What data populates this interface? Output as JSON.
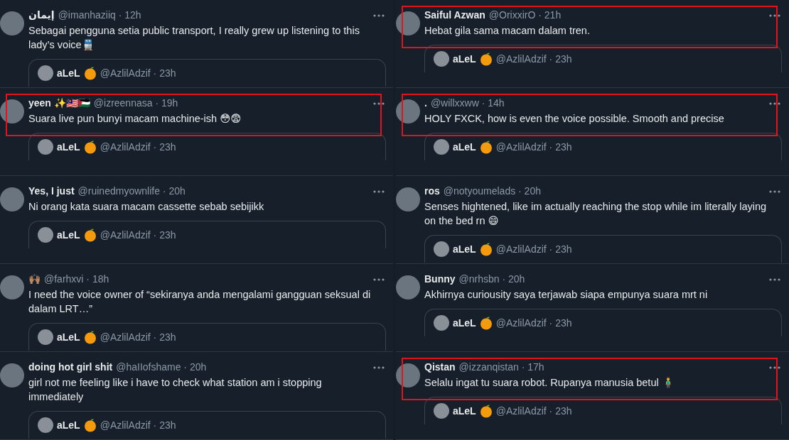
{
  "columns": [
    {
      "tweets": [
        {
          "name": "إيمان",
          "meta": "@imanhaziiq · 12h",
          "text": "Sebagai pengguna setia public transport, I really grew up listening to this lady’s voice🚆",
          "highlighted": false,
          "quote": {
            "name": "aLeL",
            "meta": "@AzlilAdzif · 23h"
          }
        },
        {
          "name": "yeen ✨🇲🇾🇵🇸",
          "meta": "@izreennasa · 19h",
          "text": "Suara live pun bunyi macam machine-ish 😳😨",
          "highlighted": true,
          "quote": {
            "name": "aLeL",
            "meta": "@AzlilAdzif · 23h"
          }
        },
        {
          "name": "Yes, I just",
          "meta": "@ruinedmyownlife · 20h",
          "text": "Ni orang kata suara macam cassette sebab sebijikk",
          "highlighted": false,
          "quote": {
            "name": "aLeL",
            "meta": "@AzlilAdzif · 23h"
          }
        },
        {
          "name": "🙌🏽",
          "meta": "@farhxvi · 18h",
          "text": "I need the voice owner of “sekiranya anda mengalami gangguan seksual di dalam LRT…”",
          "highlighted": false,
          "quote": {
            "name": "aLeL",
            "meta": "@AzlilAdzif · 23h"
          }
        },
        {
          "name": "doing hot girl shit",
          "meta": "@haIIofshame · 20h",
          "text": "girl not me feeling like i have to check what station am i stopping immediately",
          "highlighted": false,
          "quote": {
            "name": "aLeL",
            "meta": "@AzlilAdzif · 23h"
          }
        }
      ]
    },
    {
      "tweets": [
        {
          "name": "Saiful Azwan",
          "meta": "@OrixxirO · 21h",
          "text": "Hebat gila sama macam dalam tren.",
          "highlighted": true,
          "quote": {
            "name": "aLeL",
            "meta": "@AzlilAdzif · 23h"
          }
        },
        {
          "name": ".",
          "meta": "@willxxww · 14h",
          "text": "HOLY FXCK, how is even the voice possible. Smooth and precise",
          "highlighted": true,
          "quote": {
            "name": "aLeL",
            "meta": "@AzlilAdzif · 23h"
          }
        },
        {
          "name": "ros",
          "meta": "@notyoumelads · 20h",
          "text": "Senses hightened, like im actually reaching the stop while im literally laying on the bed rn 😄",
          "highlighted": false,
          "quote": {
            "name": "aLeL",
            "meta": "@AzlilAdzif · 23h"
          }
        },
        {
          "name": "Bunny",
          "meta": "@nrhsbn · 20h",
          "text": "Akhirnya curiousity saya terjawab siapa empunya suara mrt ni",
          "highlighted": false,
          "quote": {
            "name": "aLeL",
            "meta": "@AzlilAdzif · 23h"
          }
        },
        {
          "name": "Qistan",
          "meta": "@izzanqistan · 17h",
          "text": "Selalu ingat tu suara robot. Rupanya manusia betul 🧍‍♂️",
          "highlighted": true,
          "quote": {
            "name": "aLeL",
            "meta": "@AzlilAdzif · 23h"
          }
        }
      ]
    }
  ]
}
